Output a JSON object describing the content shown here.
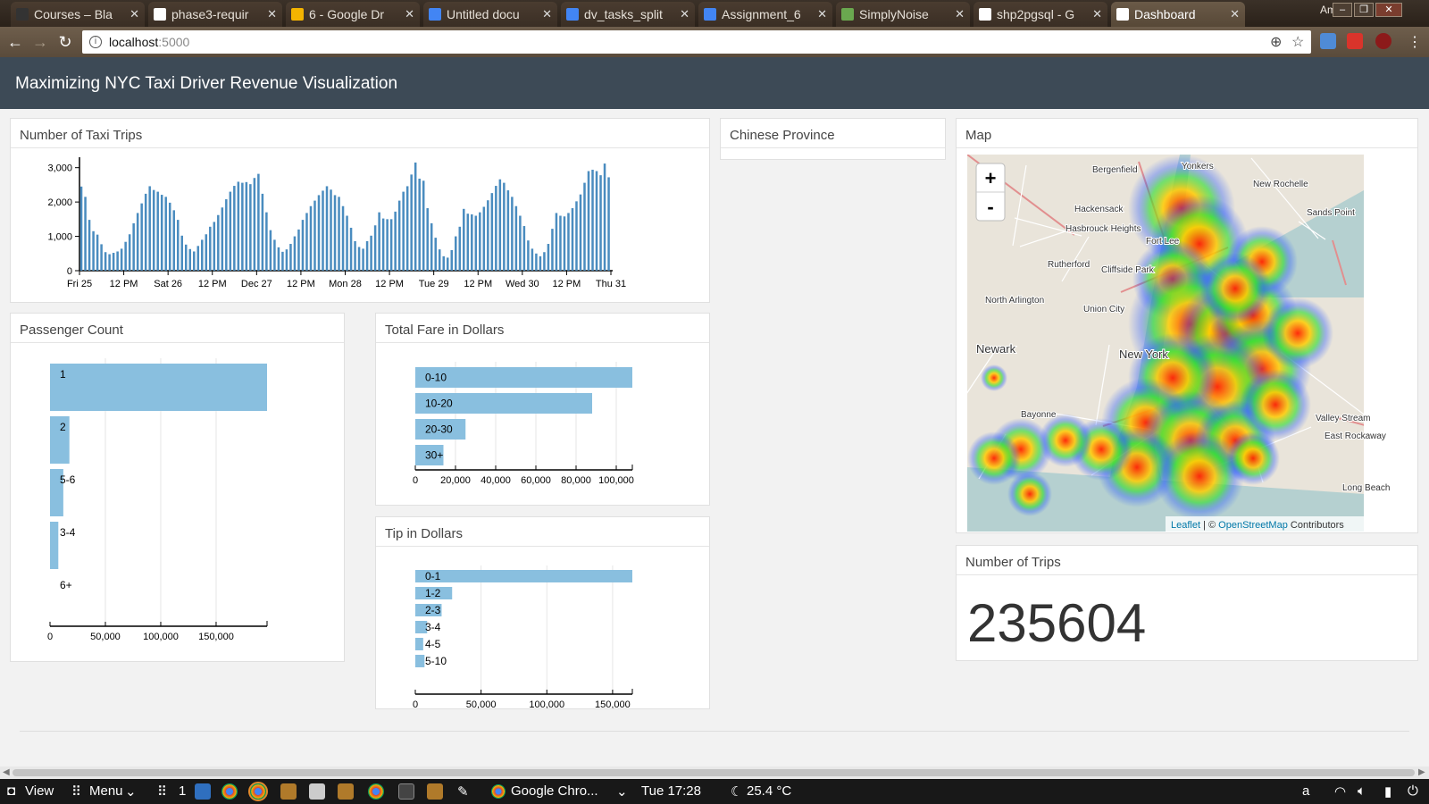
{
  "browser": {
    "tabs": [
      {
        "label": "Courses – Bla",
        "favicon_color": "#333333"
      },
      {
        "label": "phase3-requir",
        "favicon_color": "#ffffff"
      },
      {
        "label": "6 - Google Dr",
        "favicon_color": "#f4b400"
      },
      {
        "label": "Untitled docu",
        "favicon_color": "#4285f4"
      },
      {
        "label": "dv_tasks_split",
        "favicon_color": "#4285f4"
      },
      {
        "label": "Assignment_6",
        "favicon_color": "#4285f4"
      },
      {
        "label": "SimplyNoise",
        "favicon_color": "#6aa84f"
      },
      {
        "label": "shp2pgsql - G",
        "favicon_color": "#ffffff"
      },
      {
        "label": "Dashboard",
        "favicon_color": "#ffffff"
      }
    ],
    "active_tab_index": 8,
    "user": "Amrit",
    "address": {
      "host": "localhost",
      "port": ":5000"
    }
  },
  "app": {
    "title": "Maximizing NYC Taxi Driver Revenue Visualization"
  },
  "panels": {
    "trips_over_time": {
      "title": "Number of Taxi Trips"
    },
    "province": {
      "title": "Chinese Province"
    },
    "map": {
      "title": "Map",
      "zoom_in": "+",
      "zoom_out": "-",
      "attribution_link": "Leaflet",
      "attribution_sep": " | © ",
      "attribution_osm": "OpenStreetMap",
      "attribution_tail": " Contributors",
      "place_labels": [
        {
          "name": "Yonkers"
        },
        {
          "name": "Bergenfield"
        },
        {
          "name": "New Rochelle"
        },
        {
          "name": "Hackensack"
        },
        {
          "name": "Hasbrouck Heights"
        },
        {
          "name": "Fort Lee"
        },
        {
          "name": "Rutherford"
        },
        {
          "name": "Cliffside Park"
        },
        {
          "name": "North Arlington"
        },
        {
          "name": "Union City"
        },
        {
          "name": "Newark"
        },
        {
          "name": "New York"
        },
        {
          "name": "Bayonne"
        },
        {
          "name": "East Rockaway"
        },
        {
          "name": "Valley Stream"
        },
        {
          "name": "Sands Point"
        },
        {
          "name": "Long Beach"
        }
      ]
    },
    "passenger": {
      "title": "Passenger Count"
    },
    "fare": {
      "title": "Total Fare in Dollars"
    },
    "tip": {
      "title": "Tip in Dollars"
    },
    "total": {
      "title": "Number of Trips",
      "value": "235604"
    }
  },
  "chart_data": [
    {
      "type": "bar",
      "name": "trips_over_time",
      "title": "Number of Taxi Trips",
      "x_tick_labels": [
        "Fri 25",
        "12 PM",
        "Sat 26",
        "12 PM",
        "Dec 27",
        "12 PM",
        "Mon 28",
        "12 PM",
        "Tue 29",
        "12 PM",
        "Wed 30",
        "12 PM",
        "Thu 31"
      ],
      "ylim": [
        0,
        3200
      ],
      "y_ticks": [
        0,
        1000,
        2000,
        3000
      ],
      "y_tick_labels": [
        "0",
        "1,000",
        "2,000",
        "3,000"
      ],
      "values": [
        2450,
        2150,
        1480,
        1150,
        1050,
        770,
        540,
        480,
        520,
        560,
        640,
        840,
        1060,
        1380,
        1680,
        1960,
        2240,
        2460,
        2350,
        2300,
        2210,
        2150,
        1980,
        1760,
        1480,
        1020,
        760,
        630,
        560,
        720,
        900,
        1060,
        1280,
        1420,
        1620,
        1840,
        2080,
        2300,
        2470,
        2590,
        2560,
        2580,
        2520,
        2700,
        2820,
        2240,
        1700,
        1180,
        900,
        680,
        550,
        620,
        780,
        1000,
        1200,
        1480,
        1680,
        1880,
        2040,
        2200,
        2330,
        2460,
        2360,
        2200,
        2150,
        1880,
        1600,
        1250,
        860,
        690,
        640,
        860,
        1020,
        1320,
        1700,
        1520,
        1500,
        1500,
        1720,
        2040,
        2300,
        2460,
        2800,
        3150,
        2680,
        2620,
        1820,
        1380,
        960,
        620,
        420,
        380,
        600,
        1000,
        1280,
        1800,
        1660,
        1640,
        1600,
        1700,
        1860,
        2050,
        2260,
        2470,
        2660,
        2560,
        2340,
        2150,
        1880,
        1600,
        1300,
        880,
        640,
        500,
        420,
        540,
        780,
        1220,
        1680,
        1600,
        1580,
        1680,
        1820,
        2020,
        2220,
        2560,
        2900,
        2940,
        2900,
        2780,
        3120,
        2720
      ]
    },
    {
      "type": "bar",
      "name": "passenger_count",
      "title": "Passenger Count",
      "orientation": "horizontal",
      "categories": [
        "1",
        "2",
        "5-6",
        "3-4",
        "6+"
      ],
      "values": [
        196000,
        17500,
        12000,
        7500,
        0
      ],
      "xlim": [
        0,
        196000
      ],
      "x_ticks": [
        0,
        50000,
        100000,
        150000
      ],
      "x_tick_labels": [
        "0",
        "50,000",
        "100,000",
        "150,000"
      ],
      "color": "#89bfdf"
    },
    {
      "type": "bar",
      "name": "total_fare",
      "title": "Total Fare in Dollars",
      "orientation": "horizontal",
      "categories": [
        "0-10",
        "10-20",
        "20-30",
        "30+"
      ],
      "values": [
        108000,
        88000,
        25000,
        14000
      ],
      "xlim": [
        0,
        108000
      ],
      "x_ticks": [
        0,
        20000,
        40000,
        60000,
        80000,
        100000
      ],
      "x_tick_labels": [
        "0",
        "20,000",
        "40,000",
        "60,000",
        "80,000",
        "100,000"
      ],
      "color": "#89bfdf"
    },
    {
      "type": "bar",
      "name": "tip",
      "title": "Tip in Dollars",
      "orientation": "horizontal",
      "categories": [
        "0-1",
        "1-2",
        "2-3",
        "3-4",
        "4-5",
        "5-10"
      ],
      "values": [
        165000,
        28000,
        20000,
        9000,
        6000,
        7000
      ],
      "xlim": [
        0,
        165000
      ],
      "x_ticks": [
        0,
        50000,
        100000,
        150000
      ],
      "x_tick_labels": [
        "0",
        "50,000",
        "100,000",
        "150,000"
      ],
      "color": "#89bfdf"
    }
  ],
  "taskbar": {
    "view_label": "View",
    "menu_label": "Menu",
    "workspace": "1",
    "window_title": "Google Chro...",
    "clock": "Tue 17:28",
    "temperature": "25.4 °C"
  }
}
